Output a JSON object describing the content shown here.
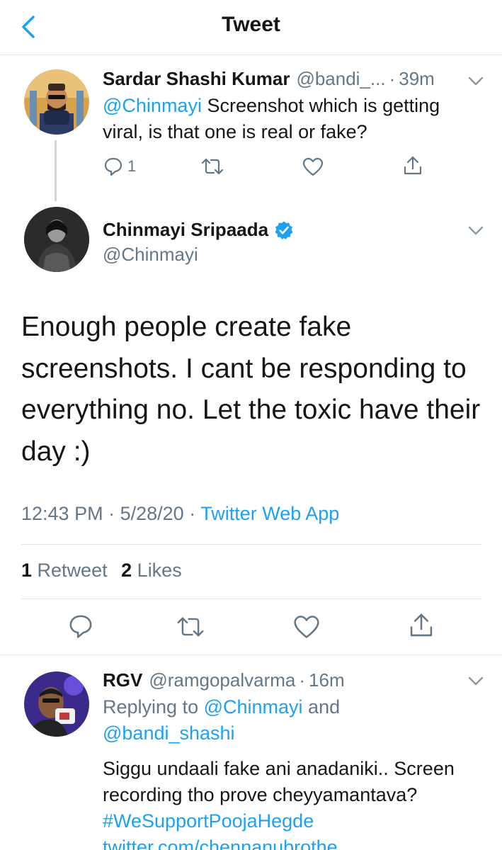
{
  "header": {
    "title": "Tweet"
  },
  "parent_tweet": {
    "display_name": "Sardar Shashi Kumar",
    "handle": "@bandi_...",
    "separator": "·",
    "time": "39m",
    "mention": "@Chinmayi",
    "text": " Screenshot which is getting viral, is that one is real or fake?",
    "reply_count": "1"
  },
  "main_tweet": {
    "display_name": "Chinmayi Sripaada",
    "handle": "@Chinmayi",
    "text": "Enough people create fake screenshots. I cant be responding to everything no. Let the toxic have their day :)",
    "time": "12:43 PM",
    "date": "5/28/20",
    "separator": "·",
    "source": "Twitter Web App",
    "retweet_count": "1",
    "retweet_label": "Retweet",
    "like_count": "2",
    "like_label": "Likes"
  },
  "reply_tweet": {
    "display_name": "RGV",
    "handle": "@ramgopalvarma",
    "separator": "·",
    "time": "16m",
    "replying_prefix": "Replying to ",
    "replying_user1": "@Chinmayi",
    "replying_and": " and",
    "replying_user2": "@bandi_shashi",
    "text": "Siggu undaali fake ani anadaniki.. Screen recording tho prove cheyyamantava?",
    "hashtag": "#WeSupportPoojaHegde",
    "link_partial": "twitter.com/chennanubrothe"
  },
  "colors": {
    "accent": "#1da1f2",
    "secondary_text": "#657786",
    "divider": "#e1e8ed",
    "verified": "#1da1f2"
  },
  "icons": [
    "back-chevron-icon",
    "chevron-down-icon",
    "reply-icon",
    "retweet-icon",
    "like-icon",
    "share-icon",
    "verified-badge-icon"
  ]
}
